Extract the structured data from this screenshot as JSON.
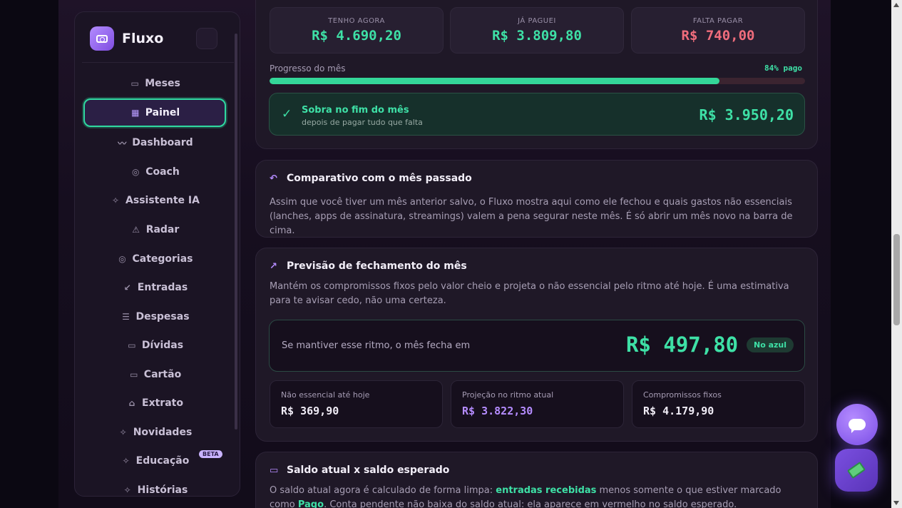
{
  "brand": {
    "name": "Fluxo"
  },
  "sidebar": {
    "items": [
      {
        "label": "Meses",
        "icon": "calendar-icon",
        "glyph": "▭"
      },
      {
        "label": "Painel",
        "icon": "grid-icon",
        "glyph": "▦",
        "active": true
      },
      {
        "label": "Dashboard",
        "icon": "trend-icon",
        "glyph": "〰"
      },
      {
        "label": "Coach",
        "icon": "target-icon",
        "glyph": "◎"
      },
      {
        "label": "Assistente IA",
        "icon": "sparkle-icon",
        "glyph": "✧"
      },
      {
        "label": "Radar",
        "icon": "warning-icon",
        "glyph": "⚠"
      },
      {
        "label": "Categorias",
        "icon": "target-icon",
        "glyph": "◎"
      },
      {
        "label": "Entradas",
        "icon": "arrow-down-left-icon",
        "glyph": "↙"
      },
      {
        "label": "Despesas",
        "icon": "list-icon",
        "glyph": "☰"
      },
      {
        "label": "Dívidas",
        "icon": "calendar-icon",
        "glyph": "▭"
      },
      {
        "label": "Cartão",
        "icon": "card-icon",
        "glyph": "▭"
      },
      {
        "label": "Extrato",
        "icon": "bank-icon",
        "glyph": "⌂"
      },
      {
        "label": "Novidades",
        "icon": "sparkle-icon",
        "glyph": "✧"
      },
      {
        "label": "Educação",
        "icon": "sparkle-icon",
        "glyph": "✧",
        "badge": "BETA"
      },
      {
        "label": "Histórias",
        "icon": "sparkle-icon",
        "glyph": "✧"
      }
    ]
  },
  "summary": {
    "stats": [
      {
        "label": "TENHO AGORA",
        "value": "R$ 4.690,20",
        "tone": "green"
      },
      {
        "label": "JÁ PAGUEI",
        "value": "R$ 3.809,80",
        "tone": "green"
      },
      {
        "label": "FALTA PAGAR",
        "value": "R$ 740,00",
        "tone": "red"
      }
    ],
    "progress_label": "Progresso do mês",
    "progress_text": "84% pago",
    "progress_value": 0.84,
    "sobra_title": "Sobra no fim do mês",
    "sobra_sub": "depois de pagar tudo que falta",
    "sobra_value": "R$ 3.950,20"
  },
  "comparativo": {
    "title": "Comparativo com o mês passado",
    "text": "Assim que você tiver um mês anterior salvo, o Fluxo mostra aqui como ele fechou e quais gastos não essenciais (lanches, apps de assinatura, streamings) valem a pena segurar neste mês. É só abrir um mês novo na barra de cima."
  },
  "previsao": {
    "title": "Previsão de fechamento do mês",
    "text": "Mantém os compromissos fixos pelo valor cheio e projeta o não essencial pelo ritmo até hoje. É uma estimativa para te avisar cedo, não uma certeza.",
    "projection_text": "Se mantiver esse ritmo, o mês fecha em",
    "projection_value": "R$ 497,80",
    "projection_badge": "No azul",
    "minis": [
      {
        "label": "Não essencial até hoje",
        "value": "R$ 369,90",
        "tone": "white"
      },
      {
        "label": "Projeção no ritmo atual",
        "value": "R$ 3.822,30",
        "tone": "purple"
      },
      {
        "label": "Compromissos fixos",
        "value": "R$ 4.179,90",
        "tone": "white"
      }
    ]
  },
  "saldo": {
    "title": "Saldo atual x saldo esperado",
    "text_a": "O saldo atual agora é calculado de forma limpa: ",
    "text_b": "entradas recebidas",
    "text_c": " menos somente o que estiver marcado como ",
    "text_d": "Pago",
    "text_e": ". Conta pendente não baixa do saldo atual: ela aparece em vermelho no saldo esperado."
  },
  "colors": {
    "accent_green": "#3ee0a6",
    "accent_purple": "#b58cff",
    "accent_red": "#f06d7c"
  }
}
